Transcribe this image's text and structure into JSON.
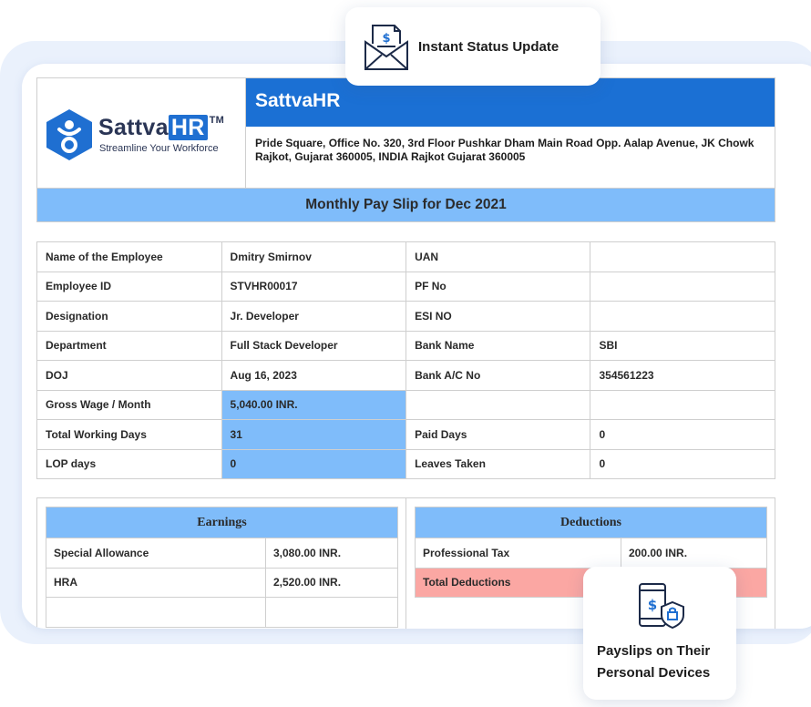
{
  "header": {
    "brand_name": "Sattva",
    "brand_hr": "HR",
    "brand_tm": "TM",
    "tagline": "Streamline Your Workforce",
    "company_name": "SattvaHR",
    "company_address": "Pride Square, Office No. 320, 3rd Floor Pushkar Dham Main Road Opp. Aalap Avenue, JK Chowk Rajkot, Gujarat 360005, INDIA Rajkot Gujarat 360005",
    "payslip_title": "Monthly Pay Slip for Dec 2021"
  },
  "employee_info": {
    "rows": [
      {
        "label1": "Name of the Employee",
        "value1": "Dmitry Smirnov",
        "label2": "UAN",
        "value2": ""
      },
      {
        "label1": "Employee ID",
        "value1": "STVHR00017",
        "label2": "PF No",
        "value2": ""
      },
      {
        "label1": "Designation",
        "value1": "Jr. Developer",
        "label2": "ESI NO",
        "value2": ""
      },
      {
        "label1": "Department",
        "value1": "Full Stack Developer",
        "label2": "Bank Name",
        "value2": "SBI"
      },
      {
        "label1": "DOJ",
        "value1": "Aug 16, 2023",
        "label2": "Bank A/C No",
        "value2": "354561223"
      },
      {
        "label1": "Gross Wage / Month",
        "value1": "5,040.00 INR.",
        "label2": "",
        "value2": ""
      },
      {
        "label1": "Total Working Days",
        "value1": "31",
        "label2": "Paid Days",
        "value2": "0"
      },
      {
        "label1": "LOP days",
        "value1": "0",
        "label2": "Leaves Taken",
        "value2": "0"
      }
    ],
    "highlight_color": "#7fbcfa"
  },
  "earnings": {
    "title": "Earnings",
    "rows": [
      {
        "label": "Special Allowance",
        "amount": "3,080.00 INR."
      },
      {
        "label": "HRA",
        "amount": "2,520.00 INR."
      },
      {
        "label": "",
        "amount": ""
      }
    ]
  },
  "deductions": {
    "title": "Deductions",
    "rows": [
      {
        "label": "Professional Tax",
        "amount": "200.00 INR."
      },
      {
        "label": "Total Deductions",
        "amount": ""
      }
    ],
    "total_color": "#fba7a3"
  },
  "feature_cards": {
    "status_update": {
      "label": "Instant Status Update",
      "icon": "envelope-invoice-icon"
    },
    "devices": {
      "line1": "Payslips on Their",
      "line2": "Personal Devices",
      "icon": "phone-lock-icon"
    }
  },
  "colors": {
    "brand_blue": "#1b70d4",
    "light_blue": "#7fbcfa",
    "frame_bg": "#eaf1fc"
  }
}
